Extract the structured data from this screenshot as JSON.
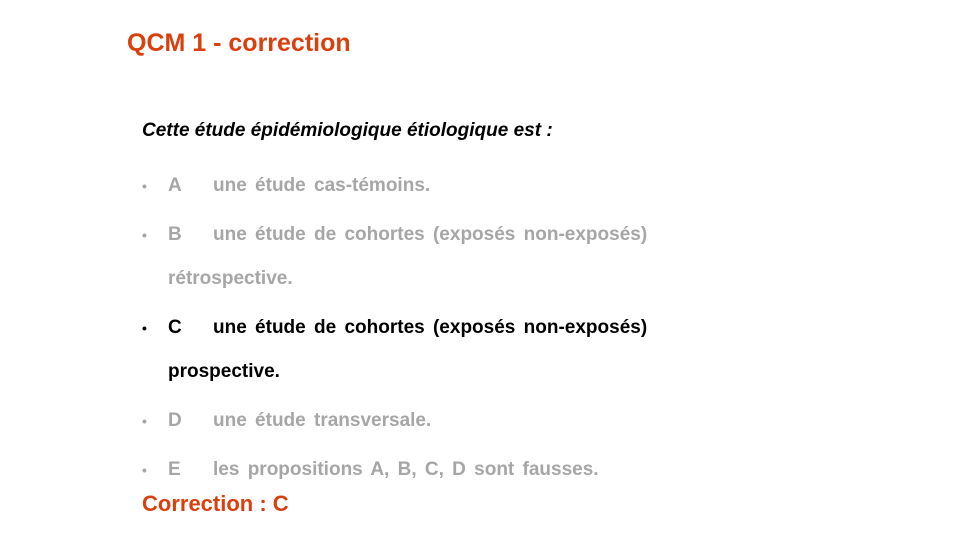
{
  "slide": {
    "title": "QCM 1 - correction",
    "question": "Cette étude épidémiologique  étiologique  est :",
    "options": [
      {
        "bullet": "•",
        "letter": "A",
        "line1": "une étude cas-témoins.",
        "line2": "",
        "correct": false
      },
      {
        "bullet": "•",
        "letter": "B",
        "line1": "une étude de cohortes (exposés non-exposés)",
        "line2": "rétrospective.",
        "correct": false
      },
      {
        "bullet": "•",
        "letter": "C",
        "line1": "une étude de cohortes (exposés non-exposés)",
        "line2": "prospective.",
        "correct": true
      },
      {
        "bullet": "•",
        "letter": "D",
        "line1": "une étude transversale.",
        "line2": "",
        "correct": false
      },
      {
        "bullet": "•",
        "letter": "E",
        "line1": "les propositions  A, B, C, D sont fausses.",
        "line2": "",
        "correct": false
      }
    ],
    "answer": "Correction : C",
    "colors": {
      "accent": "#d9400e",
      "muted": "#a6a6a6",
      "text": "#000000"
    }
  }
}
